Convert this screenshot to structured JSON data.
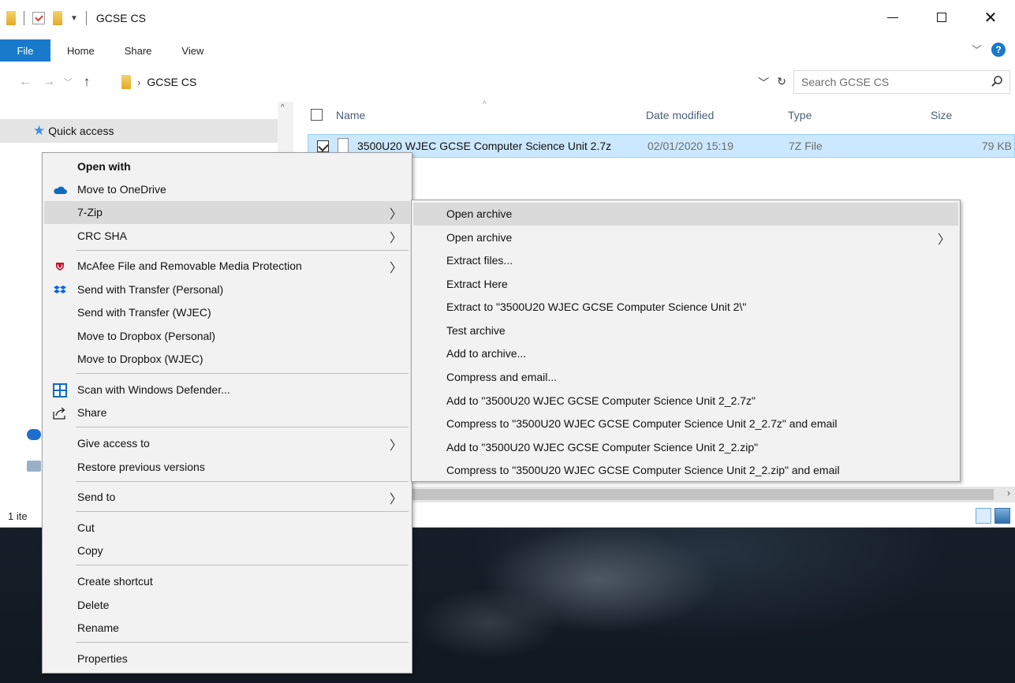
{
  "window": {
    "title": "GCSE CS",
    "ribbon_tabs": [
      "File",
      "Home",
      "Share",
      "View"
    ],
    "help_label": "?",
    "address_path": "GCSE CS",
    "search_placeholder": "Search GCSE CS"
  },
  "nav_pane": {
    "quick_access": "Quick access"
  },
  "file_list": {
    "columns": [
      "Name",
      "Date modified",
      "Type",
      "Size"
    ],
    "rows": [
      {
        "name": "3500U20 WJEC GCSE Computer Science Unit 2.7z",
        "date": "02/01/2020 15:19",
        "type": "7Z File",
        "size": "79 KB",
        "selected": true
      }
    ]
  },
  "status": {
    "items_text": "1 ite"
  },
  "context_menu": {
    "items": [
      {
        "label": "Open with",
        "bold": true
      },
      {
        "label": "Move to OneDrive",
        "icon": "onedrive-cloud-icon"
      },
      {
        "label": "7-Zip",
        "submenu": true,
        "highlighted": true
      },
      {
        "label": "CRC SHA",
        "submenu": true
      },
      {
        "label": "McAfee File and Removable Media Protection",
        "icon": "mcafee-shield-icon",
        "submenu": true
      },
      {
        "label": "Send with Transfer (Personal)",
        "icon": "dropbox-icon"
      },
      {
        "label": "Send with Transfer (WJEC)"
      },
      {
        "label": "Move to Dropbox (Personal)"
      },
      {
        "label": "Move to Dropbox (WJEC)"
      },
      {
        "label": "Scan with Windows Defender...",
        "icon": "windows-defender-icon"
      },
      {
        "label": "Share",
        "icon": "share-icon"
      },
      {
        "label": "Give access to",
        "submenu": true
      },
      {
        "label": "Restore previous versions"
      },
      {
        "label": "Send to",
        "submenu": true
      },
      {
        "label": "Cut"
      },
      {
        "label": "Copy"
      },
      {
        "label": "Create shortcut"
      },
      {
        "label": "Delete"
      },
      {
        "label": "Rename"
      },
      {
        "label": "Properties"
      }
    ]
  },
  "sevenzip_submenu": {
    "items": [
      {
        "label": "Open archive",
        "highlighted": true
      },
      {
        "label": "Open archive",
        "submenu": true
      },
      {
        "label": "Extract files..."
      },
      {
        "label": "Extract Here"
      },
      {
        "label": "Extract to \"3500U20 WJEC GCSE Computer Science Unit 2\\\""
      },
      {
        "label": "Test archive"
      },
      {
        "label": "Add to archive..."
      },
      {
        "label": "Compress and email..."
      },
      {
        "label": "Add to \"3500U20 WJEC GCSE Computer Science Unit 2_2.7z\""
      },
      {
        "label": "Compress to \"3500U20 WJEC GCSE Computer Science Unit 2_2.7z\" and email"
      },
      {
        "label": "Add to \"3500U20 WJEC GCSE Computer Science Unit 2_2.zip\""
      },
      {
        "label": "Compress to \"3500U20 WJEC GCSE Computer Science Unit 2_2.zip\" and email"
      }
    ]
  },
  "colors": {
    "accent": "#1979ca",
    "selection": "#cce8ff",
    "menu_bg": "#f2f2f2",
    "menu_highlight": "#dadada"
  }
}
